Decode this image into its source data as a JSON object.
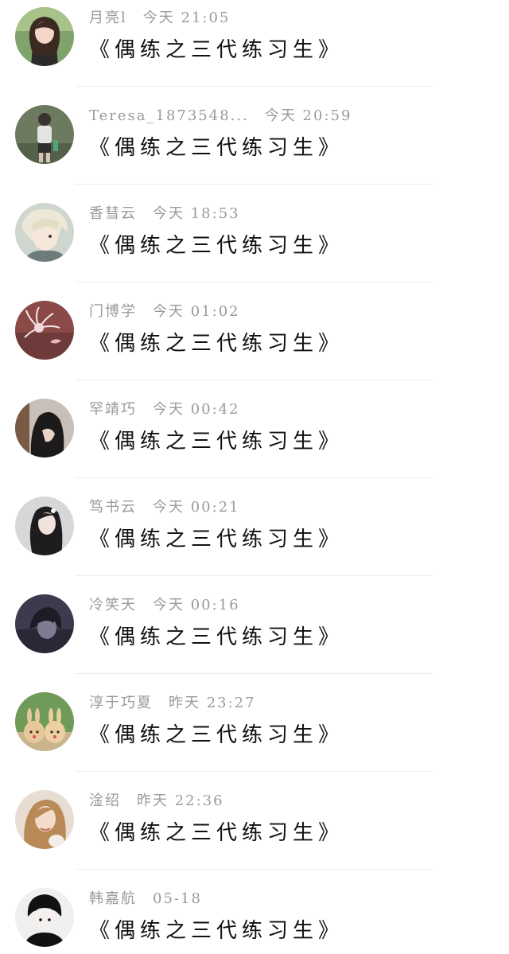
{
  "comments": [
    {
      "user": "月亮l",
      "time": "今天 21:05",
      "text": "《偶练之三代练习生》",
      "avatar_icon": "girl-school-uniform-avatar"
    },
    {
      "user": "Teresa_1873548...",
      "time": "今天 20:59",
      "text": "《偶练之三代练习生》",
      "avatar_icon": "girl-standing-avatar"
    },
    {
      "user": "香彗云",
      "time": "今天 18:53",
      "text": "《偶练之三代练习生》",
      "avatar_icon": "anime-boy-avatar"
    },
    {
      "user": "门博学",
      "time": "今天 01:02",
      "text": "《偶练之三代练习生》",
      "avatar_icon": "spider-lily-flower-avatar"
    },
    {
      "user": "罕靖巧",
      "time": "今天 00:42",
      "text": "《偶练之三代练习生》",
      "avatar_icon": "dark-hair-girl-avatar"
    },
    {
      "user": "笃书云",
      "time": "今天 00:21",
      "text": "《偶练之三代练习生》",
      "avatar_icon": "long-hair-girl-avatar"
    },
    {
      "user": "冷笑天",
      "time": "今天 00:16",
      "text": "《偶练之三代练习生》",
      "avatar_icon": "anime-dark-avatar"
    },
    {
      "user": "淳于巧夏",
      "time": "昨天 23:27",
      "text": "《偶练之三代练习生》",
      "avatar_icon": "bunny-toys-avatar"
    },
    {
      "user": "淦绍",
      "time": "昨天 22:36",
      "text": "《偶练之三代练习生》",
      "avatar_icon": "blonde-girl-avatar"
    },
    {
      "user": "韩嘉航",
      "time": "05-18",
      "text": "《偶练之三代练习生》",
      "avatar_icon": "anime-boy-black-hair-avatar"
    }
  ],
  "colors": {
    "username": "#9a9a9a",
    "text": "#111111",
    "divider": "#ededed",
    "background": "#ffffff"
  }
}
